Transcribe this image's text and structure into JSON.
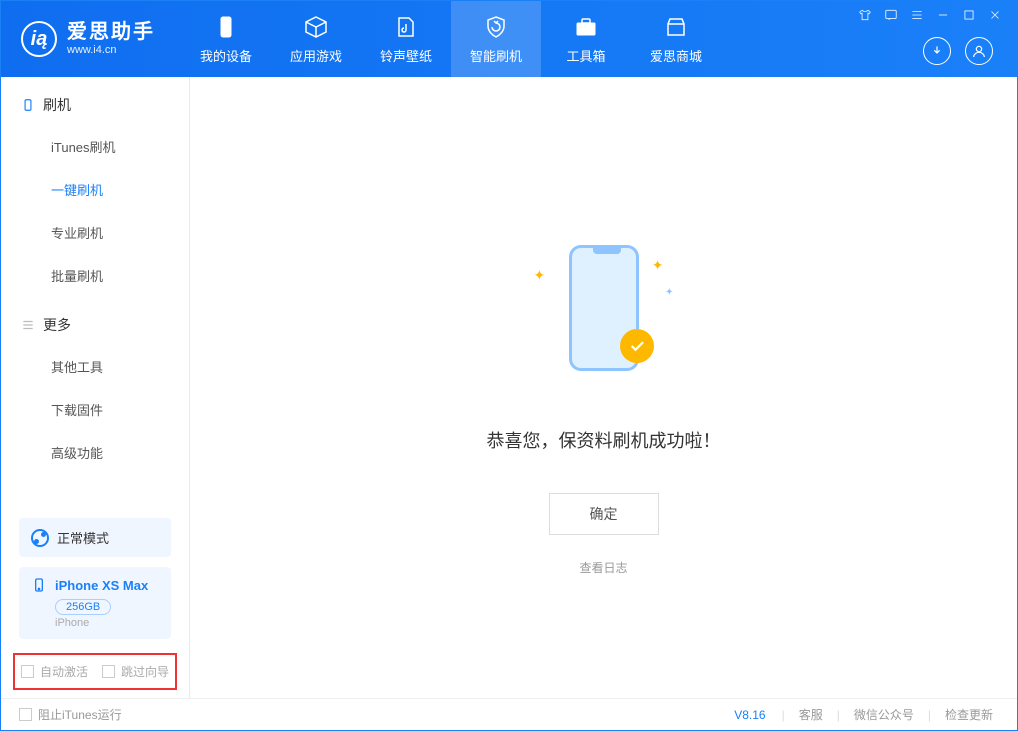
{
  "header": {
    "logo_title": "爱思助手",
    "logo_sub": "www.i4.cn",
    "nav": [
      {
        "label": "我的设备"
      },
      {
        "label": "应用游戏"
      },
      {
        "label": "铃声壁纸"
      },
      {
        "label": "智能刷机"
      },
      {
        "label": "工具箱"
      },
      {
        "label": "爱思商城"
      }
    ]
  },
  "sidebar": {
    "section1_title": "刷机",
    "section1_items": [
      {
        "label": "iTunes刷机"
      },
      {
        "label": "一键刷机"
      },
      {
        "label": "专业刷机"
      },
      {
        "label": "批量刷机"
      }
    ],
    "section2_title": "更多",
    "section2_items": [
      {
        "label": "其他工具"
      },
      {
        "label": "下载固件"
      },
      {
        "label": "高级功能"
      }
    ],
    "mode_label": "正常模式",
    "device_name": "iPhone XS Max",
    "device_capacity": "256GB",
    "device_type": "iPhone",
    "opt_auto_activate": "自动激活",
    "opt_skip_guide": "跳过向导"
  },
  "main": {
    "success_msg": "恭喜您，保资料刷机成功啦！",
    "ok_button": "确定",
    "view_log": "查看日志"
  },
  "footer": {
    "block_itunes": "阻止iTunes运行",
    "version": "V8.16",
    "link_service": "客服",
    "link_wechat": "微信公众号",
    "link_update": "检查更新"
  }
}
